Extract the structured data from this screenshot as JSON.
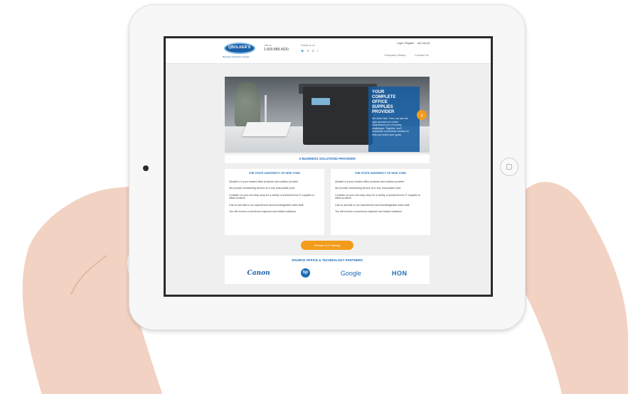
{
  "site": {
    "logo_text": "QBOLKER'S",
    "tagline": "Business Products & Supply",
    "call_label": "Call us",
    "phone": "1.800.888.4920",
    "follow_label": "Follow us on",
    "social_icons": [
      "twitter-icon",
      "pinterest-icon",
      "google-plus-icon",
      "facebook-icon"
    ],
    "social_glyphs": [
      "🐦",
      "P",
      "G",
      "f"
    ],
    "login": "Login / Register",
    "cart": "My Cart (0)",
    "nav": {
      "company": "Company History",
      "contact": "Contact Us"
    }
  },
  "hero": {
    "title": "YOUR COMPLETE OFFICE SUPPLIES PROVIDER",
    "text": "We listen first. Then, we ask the right questions to better understand your everyday challenges. Together, we'll customize a business solution to help you reach your goals.",
    "next_arrow": "›",
    "prev_arrow": "‹",
    "dot": "•"
  },
  "section_title": "A BUSINESS SOLUTIONS PROVIDER",
  "cards": [
    {
      "title": "THE STATE UNIVERSITY OF NEW YORK",
      "lines": [
        "Qbolker's is your trusted office products and solution provider.",
        "We provide outstanding service at a very reasonable price.",
        "Consider us your one-stop shop for a variety of products from IT supplies to office furniture.",
        "Call us and talk to our experienced and knowledgeable sales staff.",
        "You will receive a courteous response and helpful solutions."
      ]
    },
    {
      "title": "THE STATE UNIVERSITY OF NEW YORK",
      "lines": [
        "Qbolker's is your trusted office products and solution provider.",
        "We provide outstanding service at a very reasonable price.",
        "Consider us your one-stop shop for a variety of products from IT supplies to office furniture.",
        "Call us and talk to our experienced and knowledgeable sales staff.",
        "You will receive a courteous response and helpful solutions."
      ]
    }
  ],
  "cta_label": "Browse Our Catalog",
  "partners": {
    "title": "SOURCE OFFICE & TECHNOLOGY PARTNERS",
    "logos": [
      "Canon",
      "hp",
      "Google",
      "HON"
    ]
  },
  "colors": {
    "brand_blue": "#1b6bb6",
    "accent_orange": "#f39c1b"
  }
}
